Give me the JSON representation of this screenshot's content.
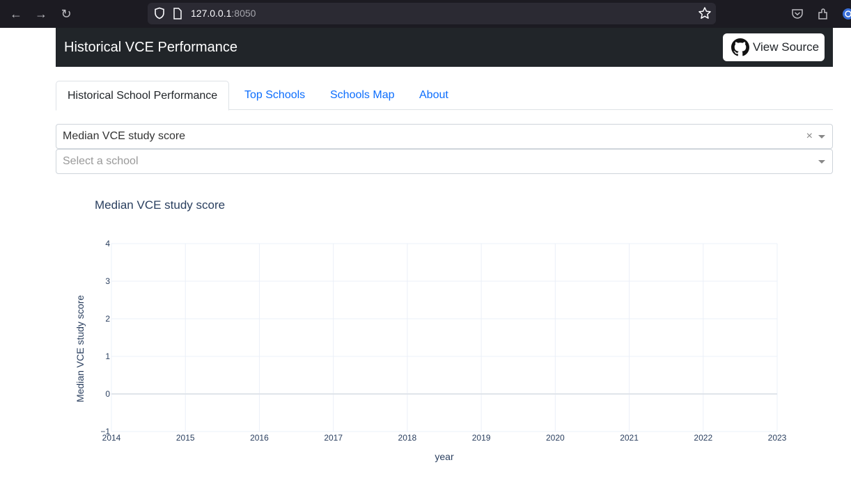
{
  "browser": {
    "url_host": "127.0.0.1",
    "url_port": ":8050"
  },
  "navbar": {
    "title": "Historical VCE Performance",
    "source_label": "View Source"
  },
  "tabs": [
    {
      "label": "Historical School Performance",
      "active": true
    },
    {
      "label": "Top Schools",
      "active": false
    },
    {
      "label": "Schools Map",
      "active": false
    },
    {
      "label": "About",
      "active": false
    }
  ],
  "metric_dropdown": {
    "value": "Median VCE study score"
  },
  "school_dropdown": {
    "placeholder": "Select a school"
  },
  "chart_data": {
    "type": "line",
    "title": "Median VCE study score",
    "xlabel": "year",
    "ylabel": "Median VCE study score",
    "x_ticks": [
      "2014",
      "2015",
      "2016",
      "2017",
      "2018",
      "2019",
      "2020",
      "2021",
      "2022",
      "2023"
    ],
    "y_ticks": [
      "4",
      "3",
      "2",
      "1",
      "0",
      "−1"
    ],
    "xlim": [
      2014,
      2023
    ],
    "ylim": [
      -1,
      4
    ],
    "grid": true,
    "series": []
  }
}
